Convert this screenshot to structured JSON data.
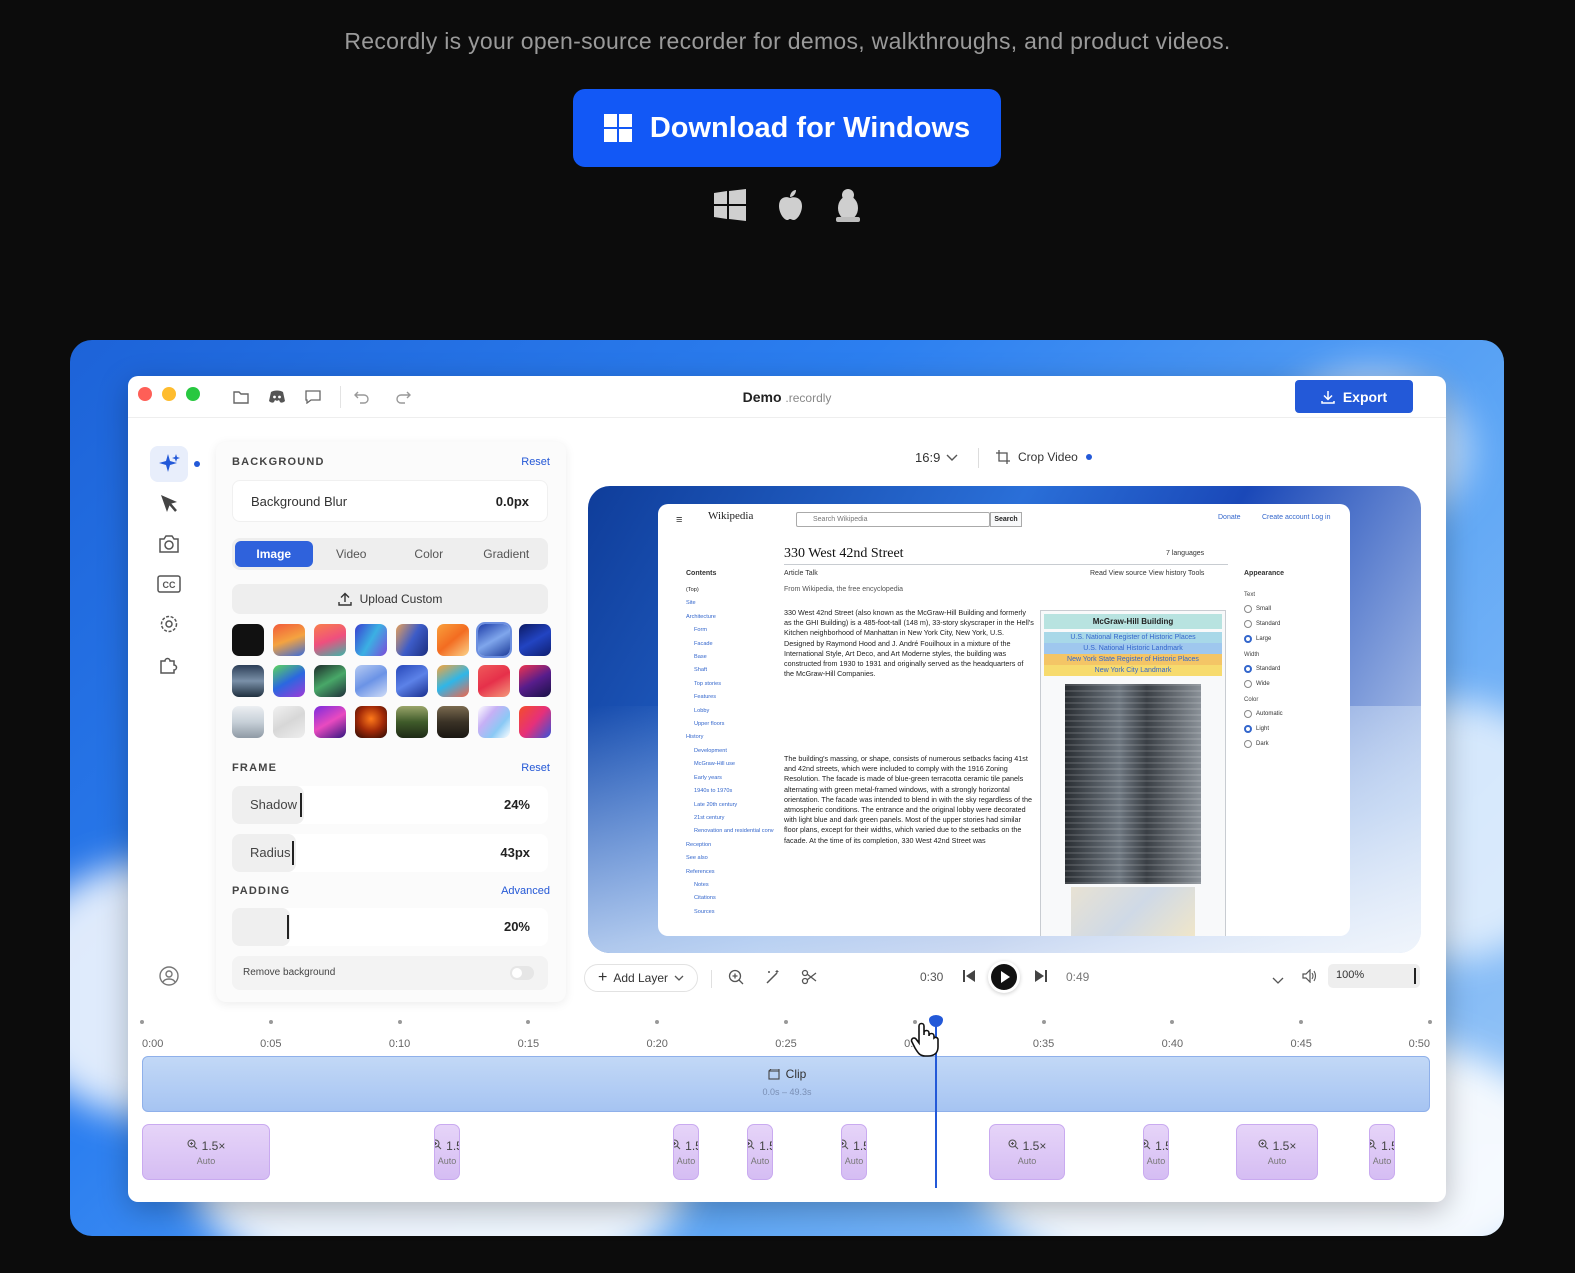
{
  "hero": {
    "tagline": "Recordly is your open-source recorder for demos, walkthroughs, and product videos.",
    "download_label": "Download for Windows",
    "os_icons": [
      "windows-icon",
      "apple-icon",
      "linux-icon"
    ]
  },
  "app": {
    "title": "Demo",
    "title_ext": ".recordly",
    "export_label": "Export",
    "aspect": "16:9",
    "crop_label": "Crop Video",
    "sidebar_icons": [
      "sparkle-icon",
      "cursor-icon",
      "camera-icon",
      "captions-icon",
      "gear-icon",
      "puzzle-icon",
      "user-icon"
    ]
  },
  "panel": {
    "background": {
      "heading": "BACKGROUND",
      "reset": "Reset",
      "blur_label": "Background Blur",
      "blur_value": "0.0px"
    },
    "tabs": [
      "Image",
      "Video",
      "Color",
      "Gradient"
    ],
    "upload_label": "Upload Custom",
    "frame": {
      "heading": "FRAME",
      "reset": "Reset",
      "shadow_label": "Shadow",
      "shadow_value": "24%",
      "shadow_level": 0.24,
      "radius_label": "Radius",
      "radius_value": "43px"
    },
    "padding": {
      "heading": "PADDING",
      "advanced": "Advanced",
      "value": "20%",
      "level": 0.2
    },
    "remove_bg_label": "Remove background"
  },
  "wiki": {
    "logo": "Wikipedia",
    "search_placeholder": "Search Wikipedia",
    "search_btn": "Search",
    "donate": "Donate",
    "account": "Create account  Log in",
    "title": "330 West 42nd Street",
    "languages": "7 languages",
    "tabs_left": "Article   Talk",
    "tabs_right": "Read   View source   View history   Tools",
    "from": "From Wikipedia, the free encyclopedia",
    "contents_heading": "Contents",
    "contents": [
      "(Top)",
      "Site",
      "Architecture",
      "Form",
      "Facade",
      "Base",
      "Shaft",
      "Top stories",
      "Features",
      "Lobby",
      "Upper floors",
      "History",
      "Development",
      "McGraw-Hill use",
      "Early years",
      "1940s to 1970s",
      "Late 20th century",
      "21st century",
      "Renovation and residential conversion",
      "Reception",
      "See also",
      "References",
      "Notes",
      "Citations",
      "Sources"
    ],
    "para1": "330 West 42nd Street (also known as the McGraw-Hill Building and formerly as the GHI Building) is a 485-foot-tall (148 m), 33-story skyscraper in the Hell's Kitchen neighborhood of Manhattan in New York City, New York, U.S. Designed by Raymond Hood and J. André Fouilhoux in a mixture of the International Style, Art Deco, and Art Moderne styles, the building was constructed from 1930 to 1931 and originally served as the headquarters of the McGraw-Hill Companies.",
    "para2": "The building's massing, or shape, consists of numerous setbacks facing 41st and 42nd streets, which were included to comply with the 1916 Zoning Resolution. The facade is made of blue-green terracotta ceramic tile panels alternating with green metal-framed windows, with a strongly horizontal orientation. The facade was intended to blend in with the sky regardless of the atmospheric conditions. The entrance and the original lobby were decorated with light blue and dark green panels. Most of the upper stories had similar floor plans, except for their widths, which varied due to the setbacks on the facade. At the time of its completion, 330 West 42nd Street was",
    "infobox_title": "McGraw-Hill Building",
    "infobox_rows": [
      "U.S. National Register of Historic Places",
      "U.S. National Historic Landmark",
      "New York State Register of Historic Places",
      "New York City Landmark"
    ],
    "appearance": {
      "heading": "Appearance",
      "text": "Text",
      "text_opts": [
        "Small",
        "Standard",
        "Large"
      ],
      "width": "Width",
      "width_opts": [
        "Standard",
        "Wide"
      ],
      "color": "Color",
      "color_opts": [
        "Automatic",
        "Light",
        "Dark"
      ]
    }
  },
  "controls": {
    "add_layer": "Add Layer",
    "current_time": "0:30",
    "end_time": "0:49",
    "volume": "100%"
  },
  "timeline": {
    "ticks": [
      "0:00",
      "0:05",
      "0:10",
      "0:15",
      "0:20",
      "0:25",
      "0:30",
      "0:35",
      "0:40",
      "0:45",
      "0:50"
    ],
    "clip_label": "Clip",
    "clip_range": "0.0s – 49.3s",
    "zooms": [
      {
        "label": "1.5×",
        "sub": "Auto"
      },
      {
        "label": "1.5",
        "sub": "Auto"
      },
      {
        "label": "1.5",
        "sub": "Auto"
      },
      {
        "label": "1.5",
        "sub": "Auto"
      },
      {
        "label": "1.5",
        "sub": "Auto"
      },
      {
        "label": "1.5×",
        "sub": "Auto"
      },
      {
        "label": "1.5",
        "sub": "Auto"
      },
      {
        "label": "1.5×",
        "sub": "Auto"
      },
      {
        "label": "1.5",
        "sub": "Auto"
      }
    ]
  }
}
